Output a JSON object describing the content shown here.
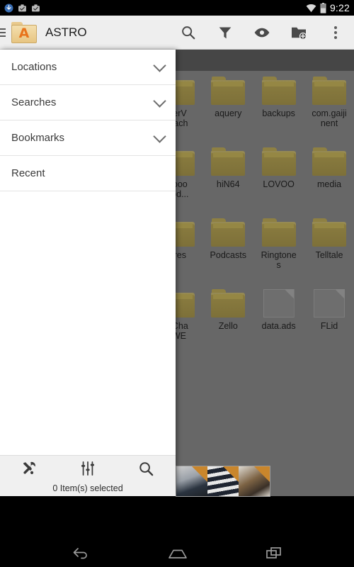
{
  "status_bar": {
    "time": "9:22",
    "left_icons": [
      "download-icon",
      "work-badge-icon",
      "work-badge-icon"
    ],
    "right_icons": [
      "wifi-icon",
      "battery-icon"
    ]
  },
  "app_bar": {
    "menu_icon": "hamburger-icon",
    "logo_icon": "astro-folder-logo",
    "logo_letter": "A",
    "title": "ASTRO",
    "actions": [
      {
        "name": "search",
        "icon": "search-icon"
      },
      {
        "name": "filter",
        "icon": "filter-funnel-icon"
      },
      {
        "name": "view",
        "icon": "eye-icon"
      },
      {
        "name": "new-folder",
        "icon": "folder-add-icon"
      },
      {
        "name": "overflow",
        "icon": "overflow-dots-icon"
      }
    ]
  },
  "drawer": {
    "items": [
      {
        "label": "Locations",
        "expandable": true
      },
      {
        "label": "Searches",
        "expandable": true
      },
      {
        "label": "Bookmarks",
        "expandable": true
      },
      {
        "label": "Recent",
        "expandable": false
      }
    ],
    "bottom_tools": [
      {
        "name": "tools",
        "icon": "tools-icon"
      },
      {
        "name": "preferences",
        "icon": "sliders-icon"
      },
      {
        "name": "search",
        "icon": "search-icon"
      }
    ],
    "selection_status": "0 Item(s) selected"
  },
  "file_grid": {
    "columns": 7,
    "items": [
      {
        "label": "",
        "type": "folder"
      },
      {
        "label": "",
        "type": "folder"
      },
      {
        "label": "",
        "type": "folder"
      },
      {
        "label": "fierV\nCach",
        "type": "folder"
      },
      {
        "label": "aquery",
        "type": "folder"
      },
      {
        "label": "backups",
        "type": "folder"
      },
      {
        "label": "com.gaiji\nnent",
        "type": "folder"
      },
      {
        "label": "",
        "type": "folder"
      },
      {
        "label": "",
        "type": "folder"
      },
      {
        "label": "",
        "type": "folder"
      },
      {
        "label": "eboo\neod...",
        "type": "folder"
      },
      {
        "label": "hiN64",
        "type": "folder"
      },
      {
        "label": "LOVOO",
        "type": "folder"
      },
      {
        "label": "media",
        "type": "folder"
      },
      {
        "label": "",
        "type": "folder"
      },
      {
        "label": "",
        "type": "folder"
      },
      {
        "label": "",
        "type": "folder"
      },
      {
        "label": "ures",
        "type": "folder"
      },
      {
        "label": "Podcasts",
        "type": "folder"
      },
      {
        "label": "Ringtone\ns",
        "type": "folder"
      },
      {
        "label": "Telltale",
        "type": "folder"
      },
      {
        "label": "",
        "type": "folder"
      },
      {
        "label": "",
        "type": "folder"
      },
      {
        "label": "",
        "type": "folder"
      },
      {
        "label": "eCha\nrWE",
        "type": "folder"
      },
      {
        "label": "Zello",
        "type": "folder"
      },
      {
        "label": "data.ads",
        "type": "file"
      },
      {
        "label": "FLid",
        "type": "file"
      }
    ]
  },
  "thumbnail_strip": {
    "count": 3,
    "badge_color": "#c9862c"
  },
  "navigation_bar": {
    "buttons": [
      {
        "name": "back",
        "icon": "back-arrow-icon"
      },
      {
        "name": "home",
        "icon": "home-pentagon-icon"
      },
      {
        "name": "recents",
        "icon": "recents-squares-icon"
      }
    ]
  },
  "colors": {
    "app_bar": "#eeeeee",
    "scrim_content": "#676767",
    "path_bar": "#464646",
    "brand_orange": "#e8741c"
  }
}
